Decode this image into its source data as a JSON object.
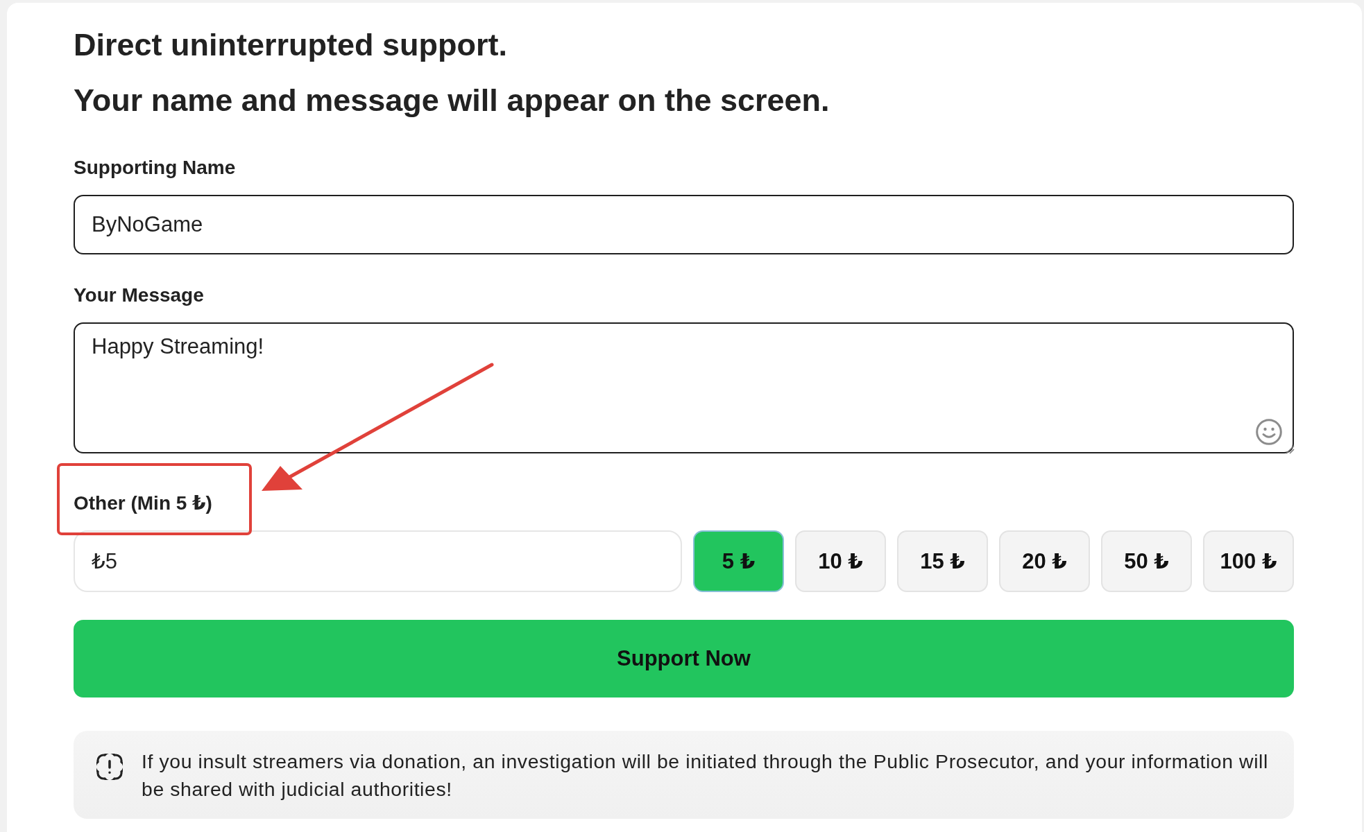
{
  "heading": {
    "lines": [
      "Direct uninterrupted support.",
      "Your name and message will appear on the screen."
    ]
  },
  "name_field": {
    "label": "Supporting Name",
    "value": "ByNoGame"
  },
  "message_field": {
    "label": "Your Message",
    "value": "Happy Streaming!"
  },
  "amount": {
    "label": "Other (Min 5 ₺)",
    "highlighted": true,
    "value": "₺5",
    "presets": [
      {
        "label": "5 ₺",
        "selected": true
      },
      {
        "label": "10 ₺",
        "selected": false
      },
      {
        "label": "15 ₺",
        "selected": false
      },
      {
        "label": "20 ₺",
        "selected": false
      },
      {
        "label": "50 ₺",
        "selected": false
      },
      {
        "label": "100 ₺",
        "selected": false
      }
    ]
  },
  "submit_button": {
    "label": "Support Now"
  },
  "notice": {
    "text": "If you insult streamers via donation, an investigation will be initiated through the Public Prosecutor, and your information will be shared with judicial authorities!"
  }
}
